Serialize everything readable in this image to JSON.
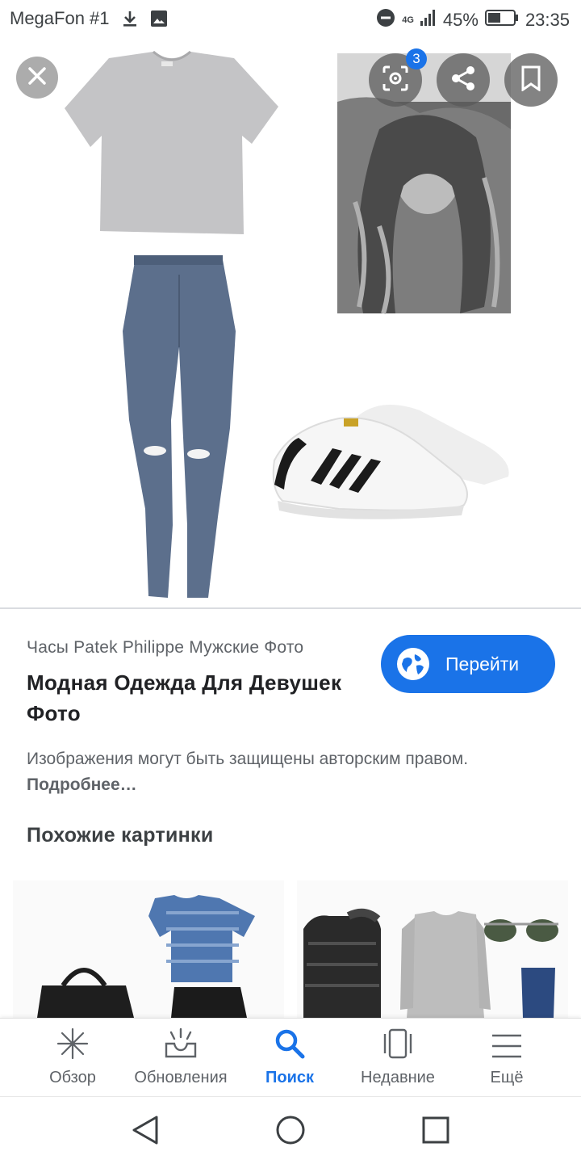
{
  "status_bar": {
    "carrier": "MegaFon #1",
    "network": "4G",
    "battery": "45%",
    "time": "23:35"
  },
  "image_viewer": {
    "close_icon": "close-icon",
    "lens_badge": "3",
    "share_icon": "share-icon",
    "bookmark_icon": "bookmark-icon"
  },
  "result": {
    "source": "Часы Patek Philippe Мужские Фото",
    "title": "Модная Одежда Для Девушек Фото",
    "visit_label": "Перейти",
    "copyright_text": "Изображения могут быть защищены авторским правом.",
    "more_link": "Подробнее…"
  },
  "similar": {
    "heading": "Похожие картинки"
  },
  "bottom_nav": {
    "items": [
      {
        "label": "Обзор",
        "icon": "discover-icon"
      },
      {
        "label": "Обновления",
        "icon": "updates-icon"
      },
      {
        "label": "Поиск",
        "icon": "search-icon"
      },
      {
        "label": "Недавние",
        "icon": "recent-icon"
      },
      {
        "label": "Ещё",
        "icon": "menu-icon"
      }
    ],
    "active": "Поиск"
  },
  "colors": {
    "accent": "#1a73e8",
    "text_primary": "#202124",
    "text_secondary": "#5f6368"
  }
}
